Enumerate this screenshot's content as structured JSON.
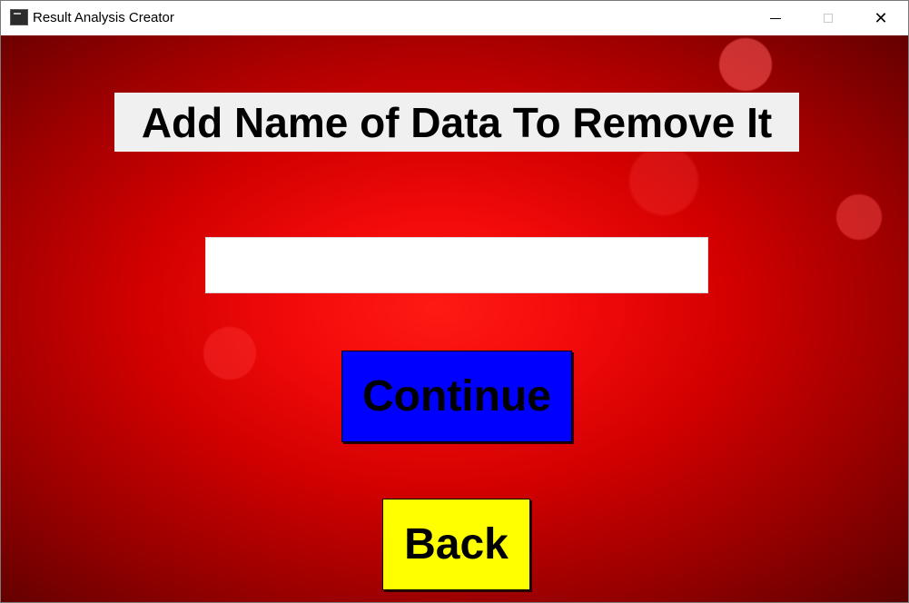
{
  "window": {
    "title": "Result Analysis Creator",
    "app_icon": "terminal-app-icon",
    "controls": {
      "minimize": "minimize-icon",
      "maximize": "maximize-icon",
      "close_glyph": "✕"
    }
  },
  "main": {
    "heading": "Add Name of Data To Remove It",
    "name_input": {
      "value": "",
      "placeholder": ""
    },
    "continue_label": "Continue",
    "back_label": "Back"
  },
  "colors": {
    "background": "#e00000",
    "heading_bg": "#f0f0f0",
    "continue_bg": "#0000ff",
    "back_bg": "#ffff00"
  }
}
